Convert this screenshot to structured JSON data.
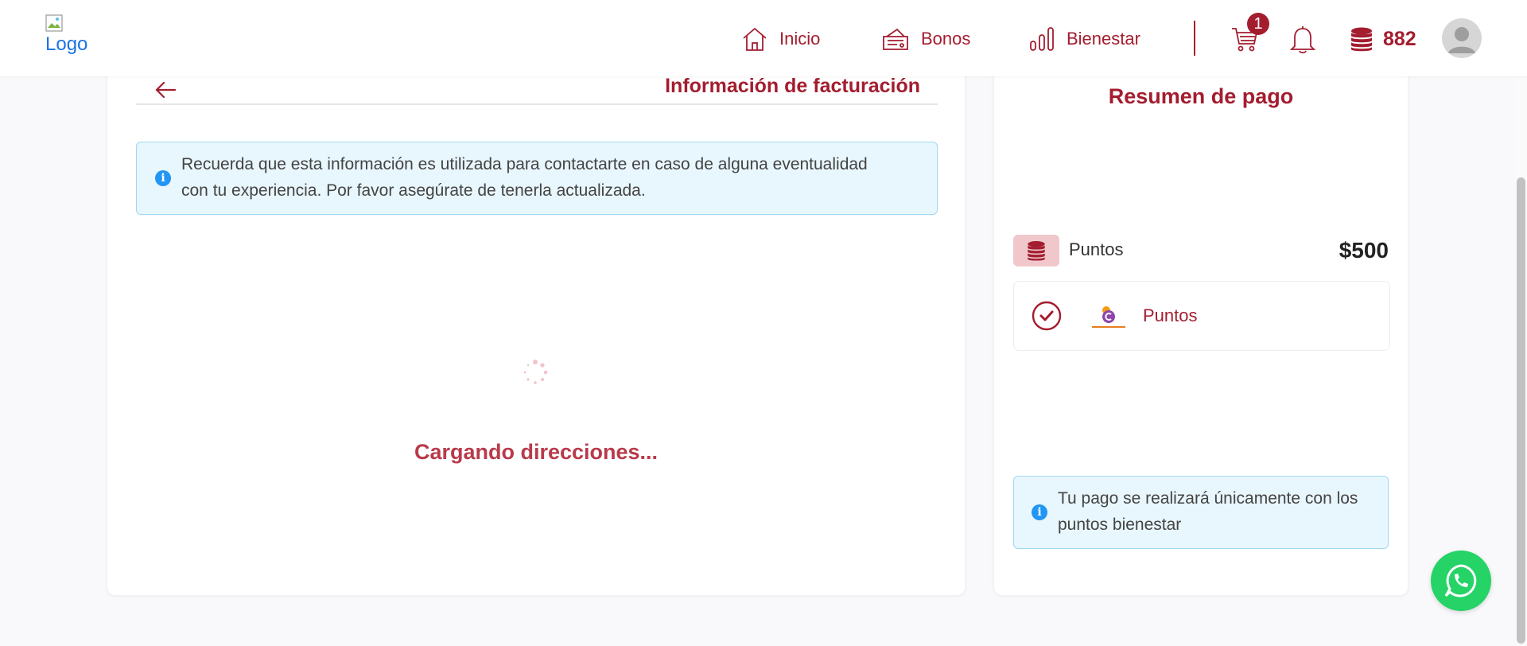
{
  "header": {
    "logo_alt": "Logo",
    "nav": [
      {
        "label": "Inicio",
        "icon": "home-icon"
      },
      {
        "label": "Bonos",
        "icon": "voucher-icon"
      },
      {
        "label": "Bienestar",
        "icon": "bar-chart-icon"
      }
    ],
    "cart_count": "1",
    "points_balance": "882",
    "accent_color": "#a31d2f"
  },
  "billing": {
    "title": "Información de facturación",
    "info_line1": "Recuerda que esta información es utilizada para contactarte en caso de alguna eventualidad",
    "info_line2": "con tu experiencia. Por favor asegúrate de tenerla actualizada.",
    "loading_text": "Cargando direcciones..."
  },
  "summary": {
    "title": "Resumen de pago",
    "points_label": "Puntos",
    "amount": "$500",
    "method_label": "Puntos",
    "notice_line1": "Tu pago se realizará únicamente con los",
    "notice_line2": "puntos bienestar"
  }
}
